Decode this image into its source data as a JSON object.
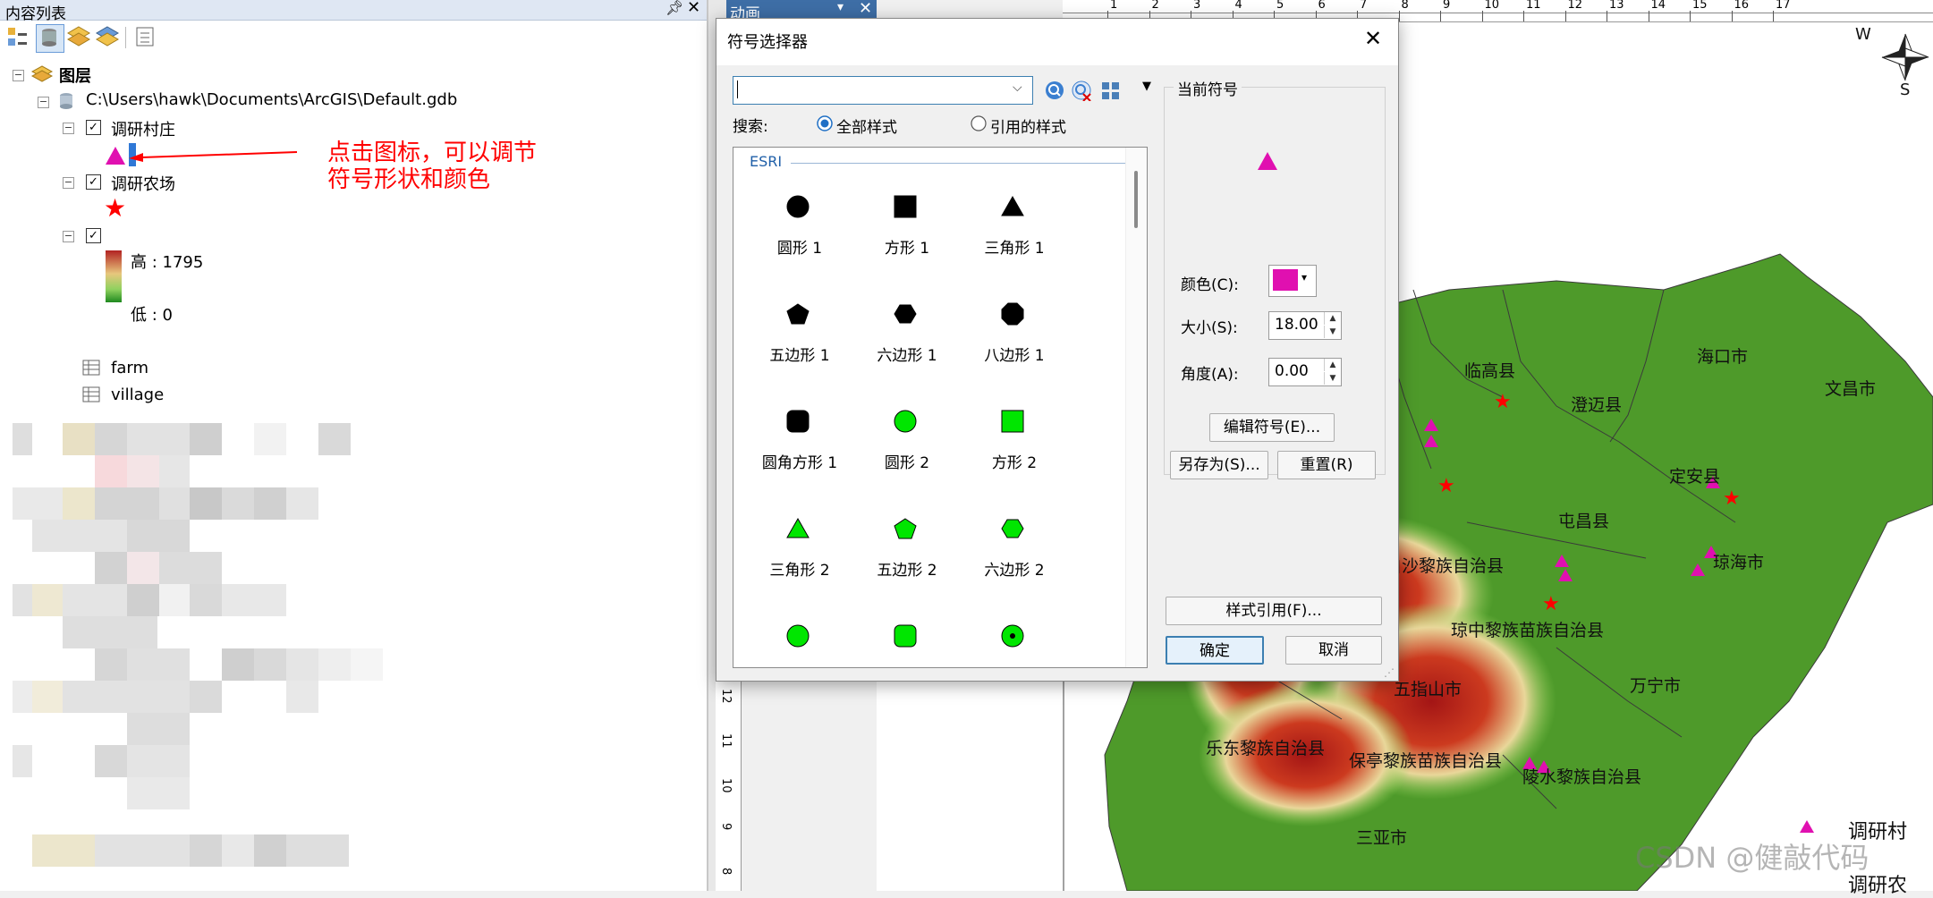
{
  "toc": {
    "title": "内容列表",
    "layers_root": "图层",
    "gdb_path": "C:\\Users\\hawk\\Documents\\ArcGIS\\Default.gdb",
    "layer1": "调研村庄",
    "layer2": "调研农场",
    "dem_high": "高 : 1795",
    "dem_low": "低 : 0",
    "table1": "farm",
    "table2": "village",
    "annotation_line1": "点击图标，可以调节",
    "annotation_line2": "符号形状和颜色"
  },
  "animation_bar": {
    "label": "动画"
  },
  "dialog": {
    "title": "符号选择器",
    "search_value": "",
    "search_label": "搜索:",
    "radio_all": "全部样式",
    "radio_ref": "引用的样式",
    "group_esri": "ESRI",
    "symbols": [
      {
        "label": "圆形 1",
        "shape": "circle",
        "color": "#000000"
      },
      {
        "label": "方形 1",
        "shape": "square",
        "color": "#000000"
      },
      {
        "label": "三角形 1",
        "shape": "triangle",
        "color": "#000000"
      },
      {
        "label": "五边形 1",
        "shape": "pentagon",
        "color": "#000000"
      },
      {
        "label": "六边形 1",
        "shape": "hexagon",
        "color": "#000000"
      },
      {
        "label": "八边形 1",
        "shape": "octagon",
        "color": "#000000"
      },
      {
        "label": "圆角方形 1",
        "shape": "roundsquare",
        "color": "#000000"
      },
      {
        "label": "圆形 2",
        "shape": "circle",
        "color": "#00e600"
      },
      {
        "label": "方形 2",
        "shape": "square",
        "color": "#00e600"
      },
      {
        "label": "三角形 2",
        "shape": "triangle",
        "color": "#00e600"
      },
      {
        "label": "五边形 2",
        "shape": "pentagon",
        "color": "#00e600"
      },
      {
        "label": "六边形 2",
        "shape": "hexagon",
        "color": "#00e600"
      },
      {
        "label": "",
        "shape": "circle",
        "color": "#00e600"
      },
      {
        "label": "",
        "shape": "roundsquare",
        "color": "#00e600"
      },
      {
        "label": "",
        "shape": "dotcircle",
        "color": "#00e600"
      }
    ],
    "current_symbol_label": "当前符号",
    "current_symbol_color": "#e010b0",
    "color_label": "颜色(C):",
    "size_label": "大小(S):",
    "size_value": "18.00",
    "angle_label": "角度(A):",
    "angle_value": "0.00",
    "edit_btn": "编辑符号(E)...",
    "saveas_btn": "另存为(S)...",
    "reset_btn": "重置(R)",
    "style_ref_btn": "样式引用(F)...",
    "ok_btn": "确定",
    "cancel_btn": "取消"
  },
  "map": {
    "labels": [
      "临高县",
      "澄迈县",
      "海口市",
      "文昌市",
      "定安县",
      "屯昌县",
      "琼海市",
      "白沙黎族自治县",
      "琼中黎族苗族自治县",
      "五指山市",
      "万宁市",
      "乐东黎族自治县",
      "保亭黎族苗族自治县",
      "陵水黎族自治县",
      "三亚市"
    ],
    "legend_village": "调研村",
    "legend_farm": "调研农",
    "compass_w": "W",
    "compass_s": "S",
    "ruler_top_ticks": [
      "1",
      "2",
      "3",
      "4",
      "5",
      "6",
      "7",
      "8",
      "9",
      "10",
      "11",
      "12",
      "13",
      "14",
      "15",
      "16",
      "17"
    ],
    "ruler_left_ticks": [
      "12",
      "11",
      "10",
      "9",
      "8"
    ]
  },
  "watermark": "CSDN @健敲代码",
  "colors": {
    "village_symbol": "#e010b0",
    "farm_symbol": "#ff0000",
    "annotation": "#ff0000"
  }
}
